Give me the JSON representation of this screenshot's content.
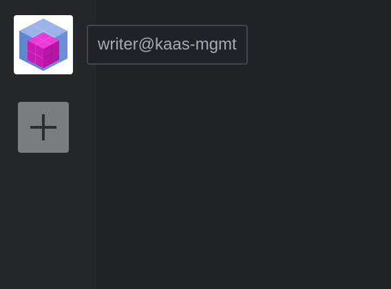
{
  "sidebar": {
    "cluster": {
      "name": "writer@kaas-mgmt",
      "icon": "cube-cluster-icon"
    },
    "add_button": {
      "icon": "plus-icon"
    }
  },
  "colors": {
    "sidebar_bg": "#25262a",
    "main_bg": "#212225",
    "add_button_bg": "#7b7c80",
    "tooltip_text": "#a9aab0",
    "cube_magenta": "#e024c8",
    "cube_blue": "#6a8fd8"
  }
}
